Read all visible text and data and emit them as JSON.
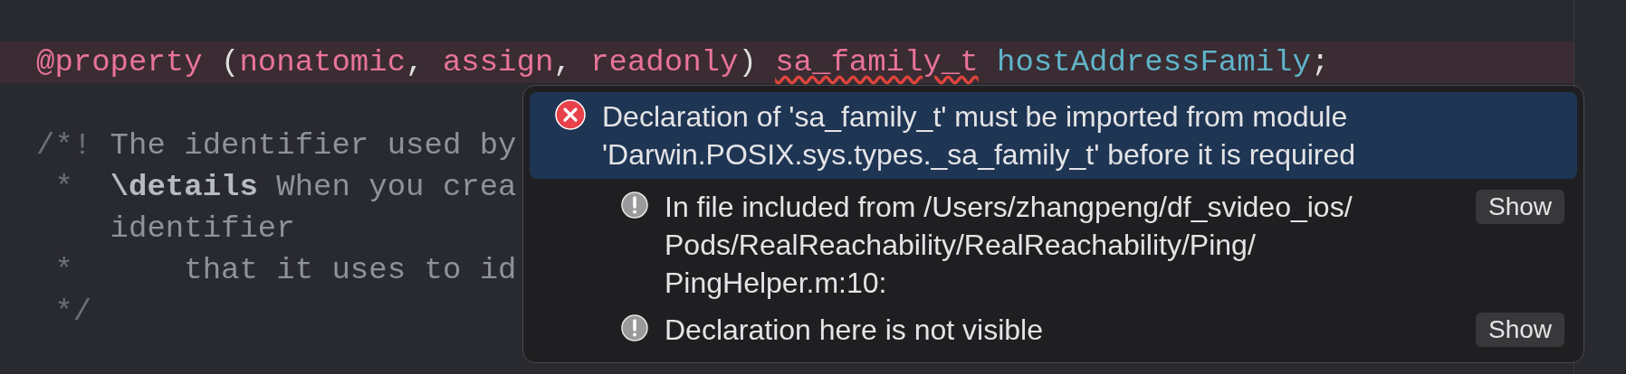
{
  "code_lines": [
    {
      "highlighted": false
    },
    {
      "highlighted": true,
      "tokens": [
        {
          "text": "@property",
          "kind": "keyword"
        },
        {
          "text": " (",
          "kind": "plain"
        },
        {
          "text": "nonatomic",
          "kind": "keyword"
        },
        {
          "text": ", ",
          "kind": "plain"
        },
        {
          "text": "assign",
          "kind": "keyword"
        },
        {
          "text": ", ",
          "kind": "plain"
        },
        {
          "text": "readonly",
          "kind": "keyword"
        },
        {
          "text": ") ",
          "kind": "plain"
        },
        {
          "text": "sa_family_t",
          "kind": "error"
        },
        {
          "text": " hostAddressFamily",
          "kind": "identifier"
        },
        {
          "text": ";",
          "kind": "plain"
        }
      ]
    },
    {
      "highlighted": false
    },
    {
      "highlighted": false,
      "tokens": [
        {
          "text": "/*!",
          "kind": "marker"
        },
        {
          "text": " The identifier used by",
          "kind": "comment"
        }
      ]
    },
    {
      "highlighted": false,
      "tokens": [
        {
          "text": " *  ",
          "kind": "marker"
        },
        {
          "text": "\\details",
          "kind": "doc_keyword"
        },
        {
          "text": " When you crea",
          "kind": "comment"
        }
      ]
    },
    {
      "highlighted": false,
      "tokens": [
        {
          "text": "    identifier",
          "kind": "comment"
        }
      ]
    },
    {
      "highlighted": false,
      "tokens": [
        {
          "text": " *",
          "kind": "marker"
        },
        {
          "text": "      that it uses to id",
          "kind": "comment"
        }
      ]
    },
    {
      "highlighted": false,
      "tokens": [
        {
          "text": " */",
          "kind": "marker"
        }
      ]
    },
    {
      "highlighted": false
    }
  ],
  "issue_popover": {
    "messages": [
      {
        "kind": "error",
        "selected": true,
        "lines": [
          "Declaration of 'sa_family_t' must be imported from module",
          "'Darwin.POSIX.sys.types._sa_family_t' before it is required"
        ]
      },
      {
        "kind": "note",
        "selected": false,
        "lines": [
          "In file included from /Users/zhangpeng/df_svideo_ios/",
          "Pods/RealReachability/RealReachability/Ping/",
          "PingHelper.m:10:"
        ],
        "button": "Show"
      },
      {
        "kind": "note",
        "selected": false,
        "lines": [
          "Declaration here is not visible"
        ],
        "button": "Show"
      }
    ]
  }
}
